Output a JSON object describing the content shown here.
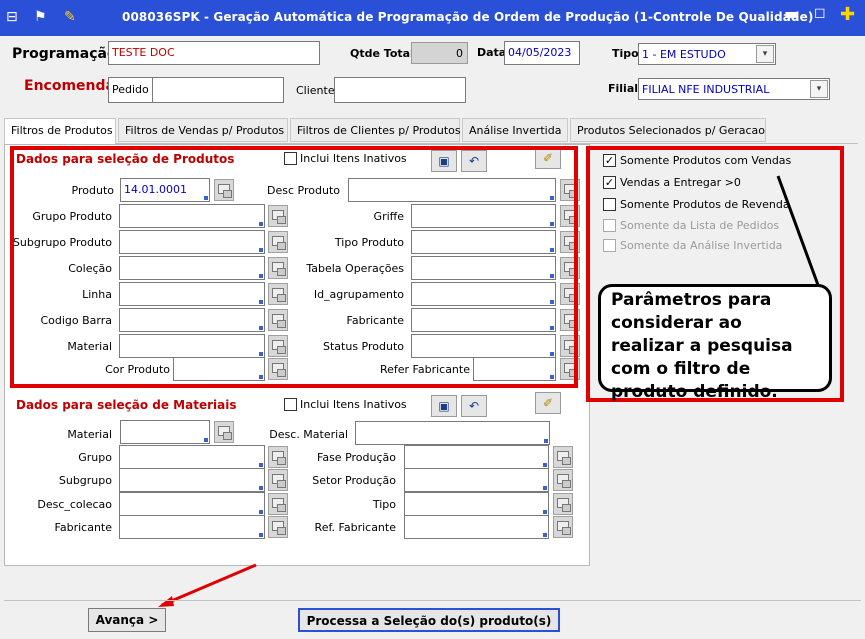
{
  "window": {
    "title": "008036SPK - Geração Automática de Programação de Ordem de Produção (1-Controle De Qualidade)",
    "minimize": "▬",
    "restore": "◻",
    "plus": "✚"
  },
  "header": {
    "programacao_label": "Programação",
    "programacao_value": "TESTE DOC",
    "qtde_total_label": "Qtde Total",
    "qtde_total_value": "0",
    "data_label": "Data",
    "data_value": "04/05/2023",
    "tipo_label": "Tipo",
    "tipo_value": "1 - EM ESTUDO",
    "encomenda_label": "Encomenda",
    "pedido_label": "Pedido",
    "pedido_value": "",
    "cliente_label": "Cliente",
    "cliente_value": "",
    "filial_label": "Filial",
    "filial_value": "FILIAL NFE INDUSTRIAL"
  },
  "tabs": [
    {
      "label": "Filtros de Produtos"
    },
    {
      "label": "Filtros de Vendas p/ Produtos"
    },
    {
      "label": "Filtros de Clientes p/ Produtos"
    },
    {
      "label": "Análise Invertida"
    },
    {
      "label": "Produtos Selecionados p/ Geracao"
    }
  ],
  "produtos": {
    "title": "Dados para seleção de Produtos",
    "inclui_inativos": "Inclui Itens Inativos",
    "produto_label": "Produto",
    "produto_value": "14.01.0001",
    "desc_produto_label": "Desc Produto",
    "left_fields": [
      "Grupo Produto",
      "Subgrupo Produto",
      "Coleção",
      "Linha",
      "Codigo Barra",
      "Material"
    ],
    "right_fields": [
      "Griffe",
      "Tipo Produto",
      "Tabela Operações",
      "Id_agrupamento",
      "Fabricante",
      "Status Produto"
    ],
    "cor_produto_label": "Cor Produto",
    "refer_fabricante_label": "Refer Fabricante"
  },
  "materiais": {
    "title": "Dados para seleção de Materiais",
    "inclui_inativos": "Inclui Itens Inativos",
    "material_label": "Material",
    "desc_material_label": "Desc. Material",
    "left_fields": [
      "Grupo",
      "Subgrupo",
      "Desc_colecao",
      "Fabricante"
    ],
    "right_fields": [
      "Fase Produção",
      "Setor Produção",
      "Tipo",
      "Ref. Fabricante"
    ]
  },
  "options": [
    {
      "label": "Somente Produtos com Vendas",
      "checked": true,
      "enabled": true
    },
    {
      "label": "Vendas a Entregar >0",
      "checked": true,
      "enabled": true
    },
    {
      "label": "Somente Produtos de Revenda",
      "checked": false,
      "enabled": true
    },
    {
      "label": "Somente da Lista de Pedidos",
      "checked": false,
      "enabled": false
    },
    {
      "label": "Somente da Análise Invertida",
      "checked": false,
      "enabled": false
    }
  ],
  "callout": {
    "text": "Parâmetros para considerar ao realizar a pesquisa com o filtro de produto definido."
  },
  "footer": {
    "avanca_label": "Avança >",
    "processa_label": "Processa a Seleção do(s) produto(s)"
  },
  "colors": {
    "titlebar": "#2b50d8",
    "annotation_red": "#e00000",
    "label_red": "#c00000"
  }
}
